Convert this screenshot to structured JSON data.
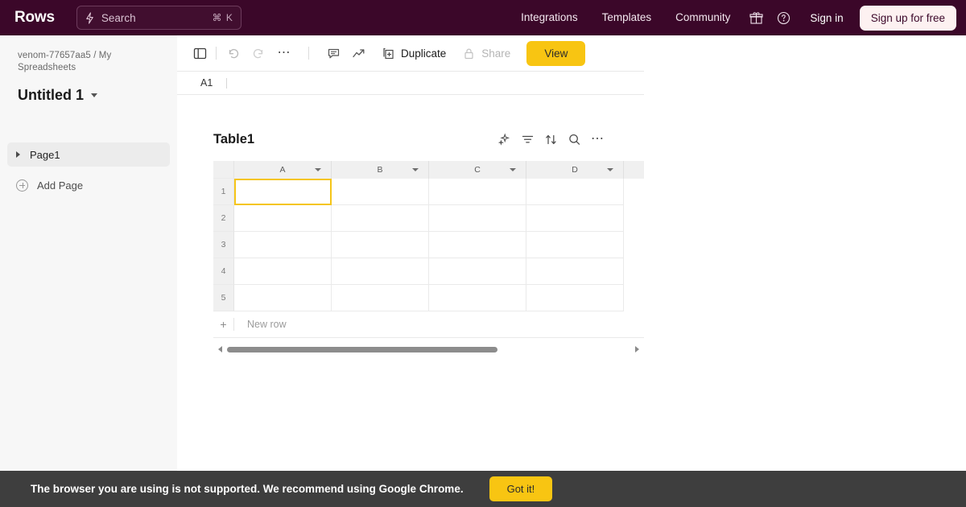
{
  "topnav": {
    "brand": "Rows",
    "search": {
      "placeholder": "Search",
      "shortcut": "⌘ K",
      "icon": "bolt-icon"
    },
    "links": [
      "Integrations",
      "Templates",
      "Community"
    ],
    "gift_icon": "gift-icon",
    "help_icon": "help-circle-icon",
    "signin_label": "Sign in",
    "signup_label": "Sign up for free",
    "bg_color": "#3b0729",
    "signup_bg": "#fdf1f1"
  },
  "sidebar": {
    "breadcrumb": "venom-77657aa5 / My Spreadsheets",
    "doc_title": "Untitled 1",
    "pages": [
      {
        "label": "Page1",
        "expanded": false
      }
    ],
    "add_page_label": "Add Page"
  },
  "toolbar": {
    "icons": [
      {
        "name": "sidebar-toggle-icon"
      },
      {
        "name": "undo-icon"
      },
      {
        "name": "redo-icon"
      },
      {
        "name": "more-horizontal-icon"
      },
      {
        "name": "comment-icon"
      },
      {
        "name": "trend-chart-icon"
      }
    ],
    "duplicate_label": "Duplicate",
    "duplicate_icon": "duplicate-icon",
    "share_label": "Share",
    "share_icon": "lock-icon",
    "share_disabled": true,
    "view_label": "View",
    "view_bg": "#f8c512"
  },
  "formula_bar": {
    "cell_ref": "A1",
    "value": ""
  },
  "table": {
    "name": "Table1",
    "tools": [
      "ai-sparkle-icon",
      "filter-icon",
      "sort-icon",
      "search-icon",
      "more-horizontal-icon"
    ],
    "columns": [
      "A",
      "B",
      "C",
      "D"
    ],
    "rows": [
      "1",
      "2",
      "3",
      "4",
      "5"
    ],
    "cells": [
      [
        "",
        "",
        "",
        ""
      ],
      [
        "",
        "",
        "",
        ""
      ],
      [
        "",
        "",
        "",
        ""
      ],
      [
        "",
        "",
        "",
        ""
      ],
      [
        "",
        "",
        "",
        ""
      ]
    ],
    "selected_cell": "A1",
    "selection_color": "#f5c518",
    "new_row_label": "New row",
    "new_row_plus": "+",
    "scroll_thumb_pct": 67
  },
  "banner": {
    "message": "The browser you are using is not supported. We recommend using Google Chrome.",
    "button_label": "Got it!",
    "bg_color": "#3e3e3e",
    "button_bg": "#f8c512"
  }
}
